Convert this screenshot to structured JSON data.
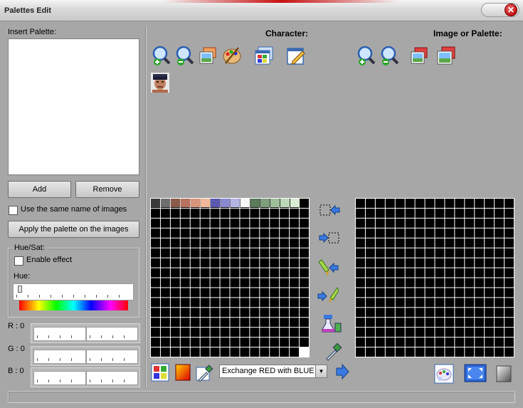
{
  "window": {
    "title": "Palettes Edit",
    "close_glyph": "✕"
  },
  "left": {
    "insert_palette_label": "Insert Palette:",
    "add_label": "Add",
    "remove_label": "Remove",
    "same_name_label": "Use the same name of images",
    "apply_label": "Apply the palette on the images",
    "hue_sat_group": "Hue/Sat:",
    "enable_effect_label": "Enable effect",
    "hue_label": "Hue:",
    "r_label": "R : 0",
    "g_label": "G : 0",
    "b_label": "B : 0"
  },
  "character": {
    "heading": "Character:",
    "toolbar": [
      "zoom-in-icon",
      "zoom-out-icon",
      "open-image-icon",
      "palette-icon",
      "window-grid-icon",
      "edit-icon"
    ],
    "palette_swatches": [
      "#3a3a3a",
      "#6e6e6e",
      "#8a5a4a",
      "#b87060",
      "#d89478",
      "#f0b898",
      "#5a58b0",
      "#8a88d0",
      "#b4b4e4",
      "#f8f8f8",
      "#5a7a5a",
      "#7e9e7c",
      "#9ebe9a",
      "#bcd8b8",
      "#d8ecd4"
    ]
  },
  "image_palette": {
    "heading": "Image or Palette:",
    "toolbar": [
      "zoom-in-icon",
      "zoom-out-icon",
      "open-image-icon",
      "save-icon"
    ]
  },
  "transfer_buttons": [
    "select-copy-left-icon",
    "select-copy-right-icon",
    "paint-copy-left-icon",
    "paint-copy-right-icon",
    "flask-icon",
    "eyedropper-icon"
  ],
  "bottom": {
    "exchange_select": "Exchange RED with BLUE",
    "select_arrow": "▼"
  },
  "colors": {
    "accent_blue": "#2f6fd6",
    "grid_bg": "#000000"
  }
}
